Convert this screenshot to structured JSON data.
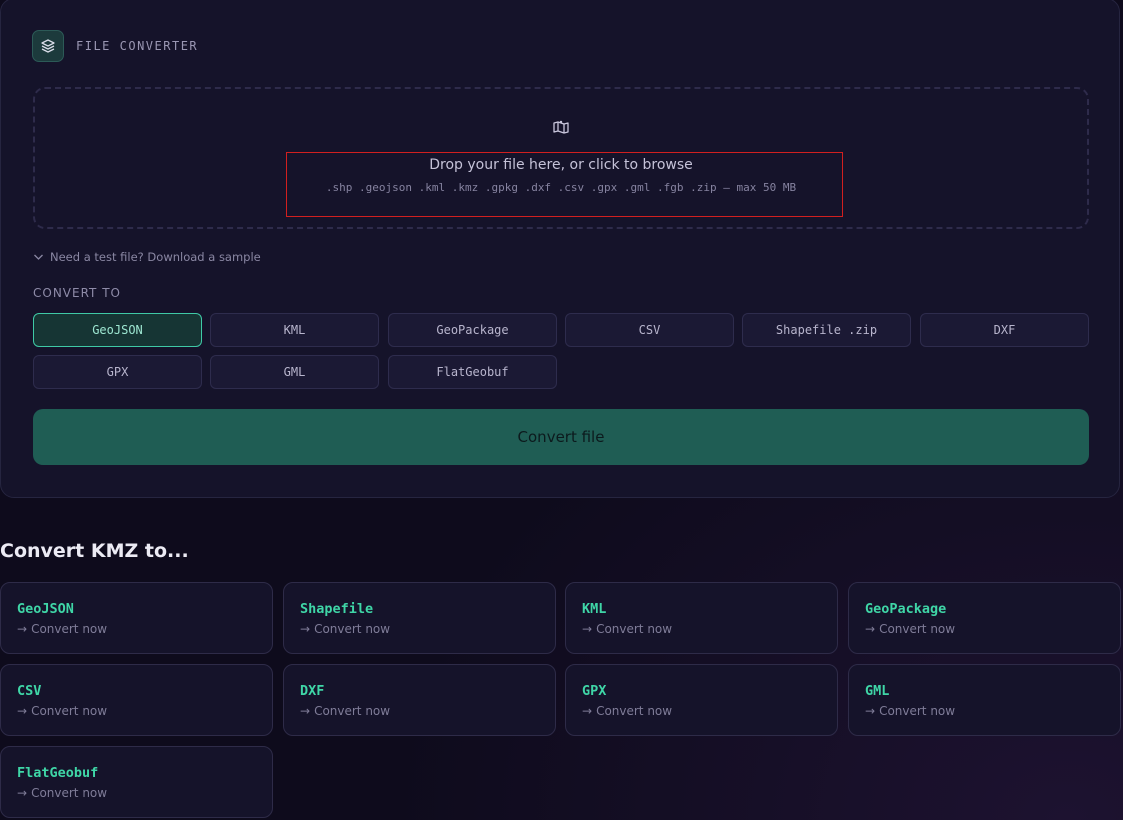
{
  "app": {
    "title": "FILE CONVERTER"
  },
  "dropzone": {
    "title": "Drop your file here, or click to browse",
    "formats": ".shp .geojson .kml .kmz .gpkg .dxf .csv .gpx .gml .fgb .zip — max 50 MB",
    "icon": "map-icon"
  },
  "sample_link": "Need a test file? Download a sample",
  "convert_to": {
    "label": "CONVERT TO",
    "selected": "GeoJSON",
    "options": [
      "GeoJSON",
      "KML",
      "GeoPackage",
      "CSV",
      "Shapefile .zip",
      "DXF",
      "GPX",
      "GML",
      "FlatGeobuf"
    ]
  },
  "convert_button": "Convert file",
  "related": {
    "title": "Convert KMZ to...",
    "action_label": "Convert now",
    "items": [
      "GeoJSON",
      "Shapefile",
      "KML",
      "GeoPackage",
      "CSV",
      "DXF",
      "GPX",
      "GML",
      "FlatGeobuf"
    ]
  },
  "colors": {
    "background": "#0e0b1c",
    "card": "#15132a",
    "accent": "#3fd6a7",
    "primary_button": "#1f5d54",
    "highlight_border": "#d11f1f"
  }
}
